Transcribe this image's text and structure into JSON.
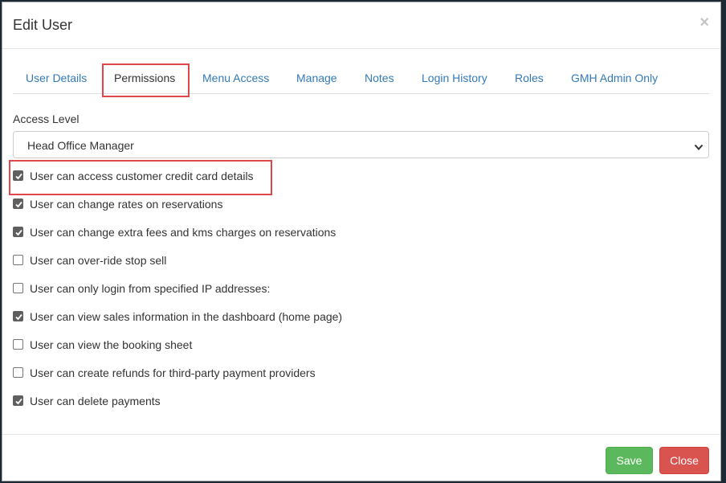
{
  "modal": {
    "title": "Edit User",
    "close_glyph": "×"
  },
  "tabs": [
    {
      "label": "User Details",
      "active": false
    },
    {
      "label": "Permissions",
      "active": true
    },
    {
      "label": "Menu Access",
      "active": false
    },
    {
      "label": "Manage",
      "active": false
    },
    {
      "label": "Notes",
      "active": false
    },
    {
      "label": "Login History",
      "active": false
    },
    {
      "label": "Roles",
      "active": false
    },
    {
      "label": "GMH Admin Only",
      "active": false
    }
  ],
  "access_level": {
    "label": "Access Level",
    "selected": "Head Office Manager"
  },
  "permissions": [
    {
      "label": "User can access customer credit card details",
      "checked": true
    },
    {
      "label": "User can change rates on reservations",
      "checked": true
    },
    {
      "label": "User can change extra fees and kms charges on reservations",
      "checked": true
    },
    {
      "label": "User can over-ride stop sell",
      "checked": false
    },
    {
      "label": "User can only login from specified IP addresses:",
      "checked": false
    },
    {
      "label": "User can view sales information in the dashboard (home page)",
      "checked": true
    },
    {
      "label": "User can view the booking sheet",
      "checked": false
    },
    {
      "label": "User can create refunds for third-party payment providers",
      "checked": false
    },
    {
      "label": "User can delete payments",
      "checked": true
    }
  ],
  "buttons": {
    "save": "Save",
    "close": "Close"
  },
  "colors": {
    "link": "#337ab7",
    "highlight": "#e0474c",
    "save": "#5cb85c",
    "close": "#d9534f"
  }
}
